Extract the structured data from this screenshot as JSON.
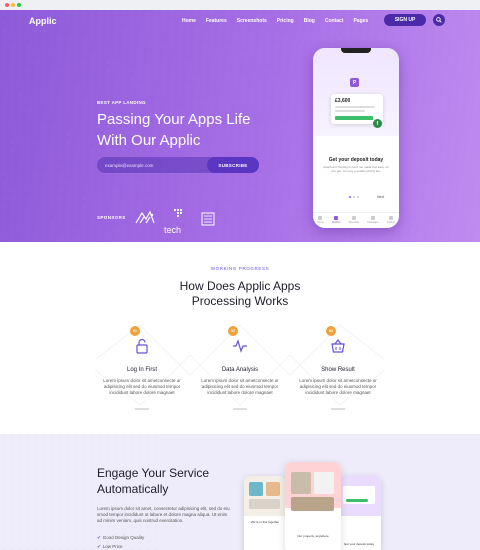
{
  "app": {
    "logo": "Applic",
    "nav": [
      "Home",
      "Features",
      "Screenshots",
      "Pricing",
      "Blog",
      "Contact",
      "Pages"
    ],
    "signup_label": "SIGN UP"
  },
  "hero": {
    "eyebrow": "BEST APP LANDING",
    "title_line1": "Passing Your Apps Life",
    "title_line2": "With Our Applic",
    "email_placeholder": "example@example.com",
    "subscribe_label": "SUBSCRIBE",
    "sponsors_label": "SPONSORS",
    "sponsor_tech": "tech"
  },
  "phone": {
    "app_letter": "P",
    "card_amount": "£3,600",
    "badge_letter": "f",
    "heading": "Get your deposit today",
    "description": "Apartment hunting is hard, we made this easy, so you get. You pay a small monthly fee.",
    "next_label": "Next",
    "tabs": [
      "Home",
      "Explore",
      "Favourite",
      "Messages",
      "Setting"
    ]
  },
  "process": {
    "eyebrow": "WORKING PROGRESS",
    "title_line1": "How Does Applic Apps",
    "title_line2": "Processing Works",
    "steps": [
      {
        "num": "01",
        "title": "Log In First",
        "text": "Lorem ipsum dolor sit ametconsecte ur adipisicing elit sed do eiusmod tempor incididunt labore dolore magnaet"
      },
      {
        "num": "02",
        "title": "Data Analysis",
        "text": "Lorem ipsum dolor sit ametconsecte ur adipisicing elit sed do eiusmod tempor incididunt labore dolore magnaet"
      },
      {
        "num": "03",
        "title": "Show Result",
        "text": "Lorem ipsum dolor sit ametconsecte ur adipisicing elit sed do eiusmod tempor incididunt labore dolore magnaet"
      }
    ]
  },
  "engage": {
    "title_line1": "Engage Your Service",
    "title_line2": "Automatically",
    "text": "Lorem ipsum dolor sit amet, consectetur adipisicing elit, sed do eiu smod tempor incididunt ut labore et dolore magna aliqua. Ut enim ad minim veniam, quis nostrud exercitation.",
    "features": [
      "Good Design Quality",
      "Low Price"
    ],
    "mock_captions": [
      "We're in this together",
      "Our property, anywhere",
      "Get your deposit today"
    ]
  },
  "colors": {
    "hero_start": "#8e5ad9",
    "hero_end": "#c08bf0",
    "button": "#4a2aa8",
    "accent": "#6a4fd8",
    "step_badge": "#f0a23a"
  }
}
